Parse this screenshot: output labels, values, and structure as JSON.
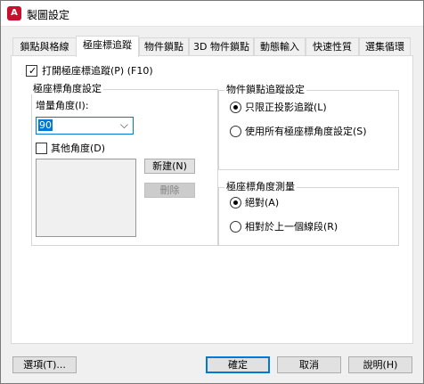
{
  "window": {
    "title": "製圖設定",
    "icon_letter": "A"
  },
  "tabs": [
    {
      "label": "鎖點與格線",
      "active": false
    },
    {
      "label": "極座標追蹤",
      "active": true
    },
    {
      "label": "物件鎖點",
      "active": false
    },
    {
      "label": "3D 物件鎖點",
      "active": false
    },
    {
      "label": "動態輸入",
      "active": false
    },
    {
      "label": "快速性質",
      "active": false
    },
    {
      "label": "選集循環",
      "active": false
    }
  ],
  "polar": {
    "enable_label": "打開極座標追蹤(P) (F10)",
    "enable_checked": true
  },
  "angle_settings": {
    "title": "極座標角度設定",
    "increment_label": "增量角度(I):",
    "increment_value": "90",
    "additional_label": "其他角度(D)",
    "additional_checked": false,
    "new_button": "新建(N)",
    "delete_button": "刪除"
  },
  "osnap_tracking": {
    "title": "物件鎖點追蹤設定",
    "option1": "只限正投影追蹤(L)",
    "option2": "使用所有極座標角度設定(S)",
    "selected": 1
  },
  "measurement": {
    "title": "極座標角度測量",
    "option1": "絕對(A)",
    "option2": "相對於上一個線段(R)",
    "selected": 1
  },
  "footer": {
    "options_button": "選項(T)...",
    "ok_button": "確定",
    "cancel_button": "取消",
    "help_button": "說明(H)"
  },
  "colors": {
    "accent": "#0078d7",
    "app_icon": "#c8102e"
  }
}
